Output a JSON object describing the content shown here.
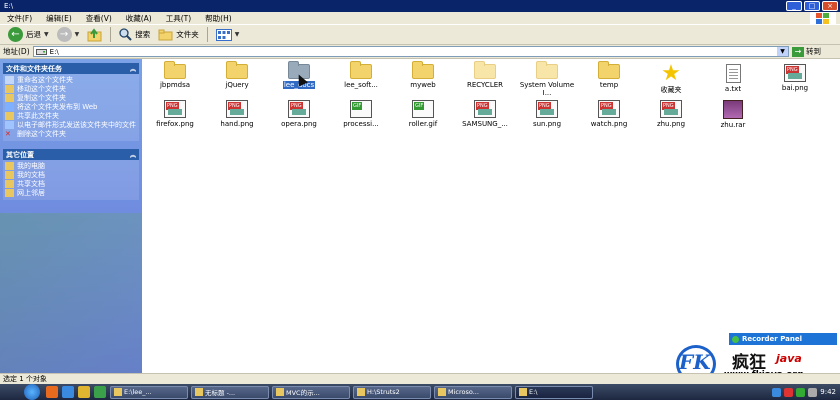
{
  "window": {
    "title": "E:\\",
    "buttons": [
      "_",
      "□",
      "×"
    ]
  },
  "menu": [
    "文件(F)",
    "编辑(E)",
    "查看(V)",
    "收藏(A)",
    "工具(T)",
    "帮助(H)"
  ],
  "toolbar": {
    "back_label": "后退",
    "search_label": "搜索",
    "folders_label": "文件夹"
  },
  "address": {
    "label": "地址(D)",
    "value": "E:\\",
    "go_label": "转到"
  },
  "left_pane": {
    "file_tasks_title": "文件和文件夹任务",
    "file_tasks": [
      {
        "label": "重命名这个文件夹",
        "icon": "rename-icon"
      },
      {
        "label": "移动这个文件夹",
        "icon": "move-icon"
      },
      {
        "label": "复制这个文件夹",
        "icon": "copy-icon"
      },
      {
        "label": "将这个文件夹发布到 Web",
        "icon": "publish-icon"
      },
      {
        "label": "共享此文件夹",
        "icon": "share-icon"
      },
      {
        "label": "以电子邮件形式发送该文件夹中的文件",
        "icon": "email-icon"
      },
      {
        "label": "删除这个文件夹",
        "icon": "delete-icon"
      }
    ],
    "other_places_title": "其它位置",
    "other_places": [
      {
        "label": "我的电脑",
        "icon": "computer-icon"
      },
      {
        "label": "我的文档",
        "icon": "documents-icon"
      },
      {
        "label": "共享文档",
        "icon": "shared-docs-icon"
      },
      {
        "label": "网上邻居",
        "icon": "network-icon"
      }
    ]
  },
  "files_row1": [
    {
      "name": "jbpmdsa",
      "type": "folder"
    },
    {
      "name": "jQuery",
      "type": "folder"
    },
    {
      "name": "lee_docs",
      "type": "folder-selected"
    },
    {
      "name": "lee_soft...",
      "type": "folder"
    },
    {
      "name": "myweb",
      "type": "folder"
    },
    {
      "name": "RECYCLER",
      "type": "folder-faded"
    },
    {
      "name": "System Volume I...",
      "type": "folder-faded"
    },
    {
      "name": "temp",
      "type": "folder"
    },
    {
      "name": "收藏夹",
      "type": "star"
    },
    {
      "name": "a.txt",
      "type": "txt"
    },
    {
      "name": "bai.png",
      "type": "png"
    }
  ],
  "files_row2": [
    {
      "name": "firefox.png",
      "type": "png"
    },
    {
      "name": "hand.png",
      "type": "png"
    },
    {
      "name": "opera.png",
      "type": "png"
    },
    {
      "name": "processi...",
      "type": "gif"
    },
    {
      "name": "roller.gif",
      "type": "gif"
    },
    {
      "name": "SAMSUNG_...",
      "type": "png"
    },
    {
      "name": "sun.png",
      "type": "png"
    },
    {
      "name": "watch.png",
      "type": "png"
    },
    {
      "name": "zhu.png",
      "type": "png"
    },
    {
      "name": "zhu.rar",
      "type": "rar"
    }
  ],
  "recorder": {
    "label": "Recorder Panel"
  },
  "logo": {
    "fk": "FK",
    "cn": "疯狂",
    "java": "java",
    "url": "www.fkjava.org"
  },
  "status": {
    "text": "选定 1 个对象"
  },
  "taskbar": {
    "tasks": [
      "E:\\lee_...",
      "无标题 -...",
      "MVC的示...",
      "H:\\Struts2",
      "Microso...",
      "E:\\"
    ],
    "tray_time": "9:42"
  }
}
